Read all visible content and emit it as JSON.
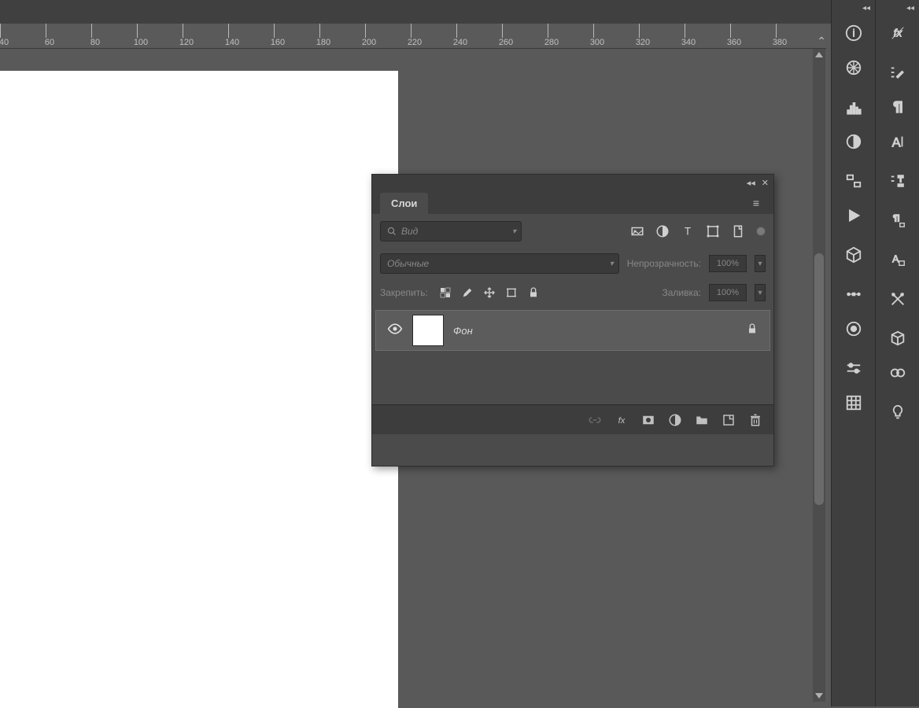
{
  "ruler": {
    "marks": [
      "40",
      "60",
      "80",
      "100",
      "120",
      "140",
      "160",
      "180",
      "200",
      "220",
      "240",
      "260",
      "280",
      "300",
      "320",
      "340",
      "360",
      "380"
    ]
  },
  "layers_panel": {
    "title": "Слои",
    "search_placeholder": "Вид",
    "blend_mode": "Обычные",
    "opacity_label": "Непрозрачность:",
    "opacity_value": "100%",
    "lock_label": "Закрепить:",
    "fill_label": "Заливка:",
    "fill_value": "100%",
    "layer": {
      "name": "Фон"
    }
  }
}
